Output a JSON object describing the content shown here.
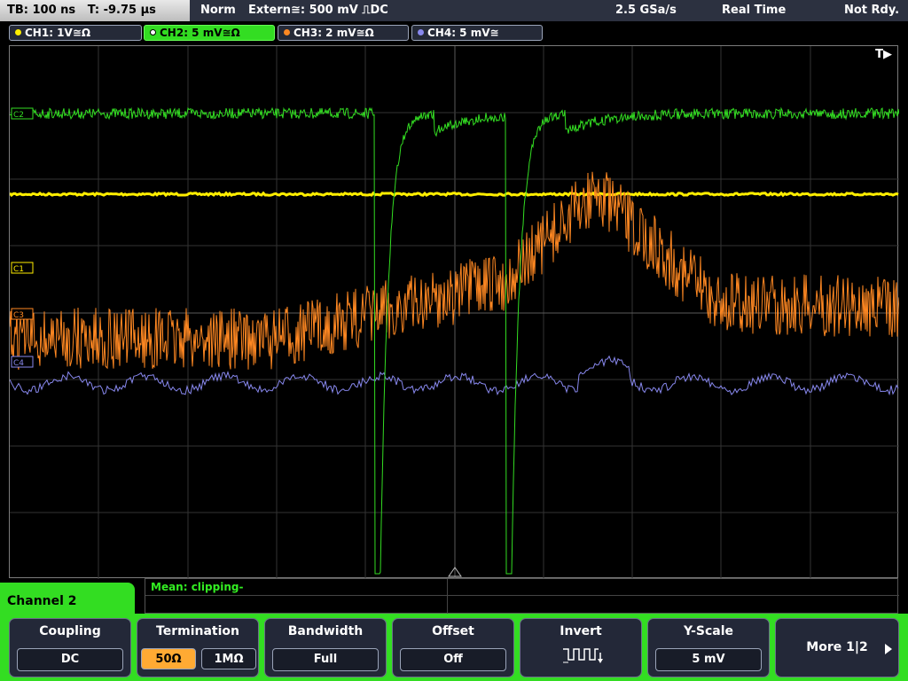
{
  "status": {
    "timebase": "TB: 100 ns   T: -9.75 µs",
    "mode": "Norm",
    "trigger": "Extern≅: 500 mV ⎍DC",
    "sample_rate": "2.5 GSa/s",
    "acquisition": "Real Time",
    "ready_state": "Not Rdy."
  },
  "channels": [
    {
      "label": "CH1: 1V≅Ω",
      "color": "#ffee00",
      "active": false
    },
    {
      "label": "CH2: 5 mV≅Ω",
      "color": "#33dd22",
      "active": true
    },
    {
      "label": "CH3: 2 mV≅Ω",
      "color": "#ff8822",
      "active": false
    },
    {
      "label": "CH4: 5 mV≅",
      "color": "#8888ee",
      "active": false
    }
  ],
  "markers": {
    "trigger_pos": "T▶",
    "c1": "C1",
    "c2": "C2",
    "c3": "C3",
    "c4": "C4"
  },
  "measurement": {
    "text": "Mean: clipping-"
  },
  "side_menu": {
    "title": "Channel 2"
  },
  "softkeys": {
    "coupling": {
      "label": "Coupling",
      "value": "DC"
    },
    "termination": {
      "label": "Termination",
      "option_a": "50Ω",
      "option_b": "1MΩ",
      "selected": "50Ω"
    },
    "bandwidth": {
      "label": "Bandwidth",
      "value": "Full"
    },
    "offset": {
      "label": "Offset",
      "value": "Off"
    },
    "invert": {
      "label": "Invert"
    },
    "yscale": {
      "label": "Y-Scale",
      "value": "5 mV"
    },
    "more": {
      "label": "More 1|2"
    }
  },
  "colors": {
    "ch1": "#ffee00",
    "ch2": "#33dd22",
    "ch3": "#ff8822",
    "ch4": "#8888ee",
    "accent": "#33dd22",
    "softkey_selected": "#ffaa33"
  }
}
